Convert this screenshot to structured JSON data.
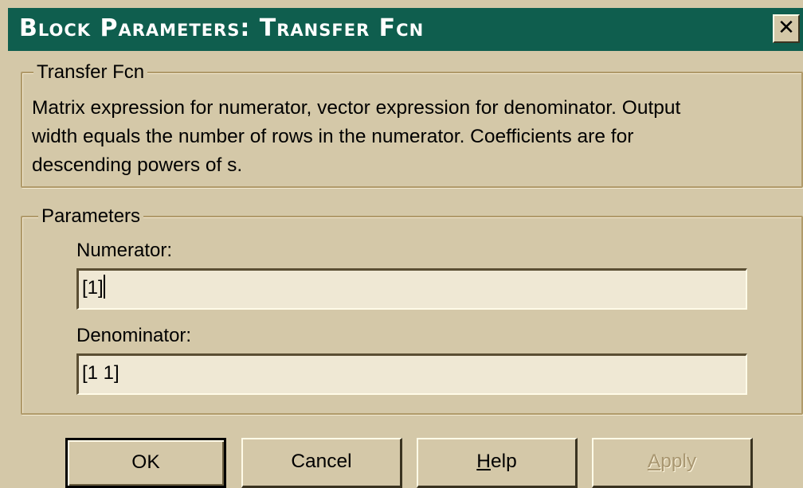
{
  "window": {
    "title": "Block Parameters: Transfer Fcn",
    "close_label": "✕"
  },
  "description_group": {
    "legend": "Transfer Fcn",
    "lines": [
      "Matrix expression for numerator, vector expression for denominator.  Output",
      "width equals the number of rows in the numerator.  Coefficients are for",
      "descending powers of s."
    ]
  },
  "parameters_group": {
    "legend": "Parameters",
    "numerator": {
      "label": "Numerator:",
      "value": "[1]"
    },
    "denominator": {
      "label": "Denominator:",
      "value": "[1 1]"
    }
  },
  "buttons": {
    "ok": "OK",
    "cancel": "Cancel",
    "help_mnemonic": "H",
    "help_rest": "elp",
    "apply_mnemonic": "A",
    "apply_rest": "pply"
  },
  "colors": {
    "titlebar": "#0f5e4e",
    "dialog_face": "#d4c8a8",
    "field_bg": "#efe8d4",
    "disabled_text": "#a89670"
  }
}
